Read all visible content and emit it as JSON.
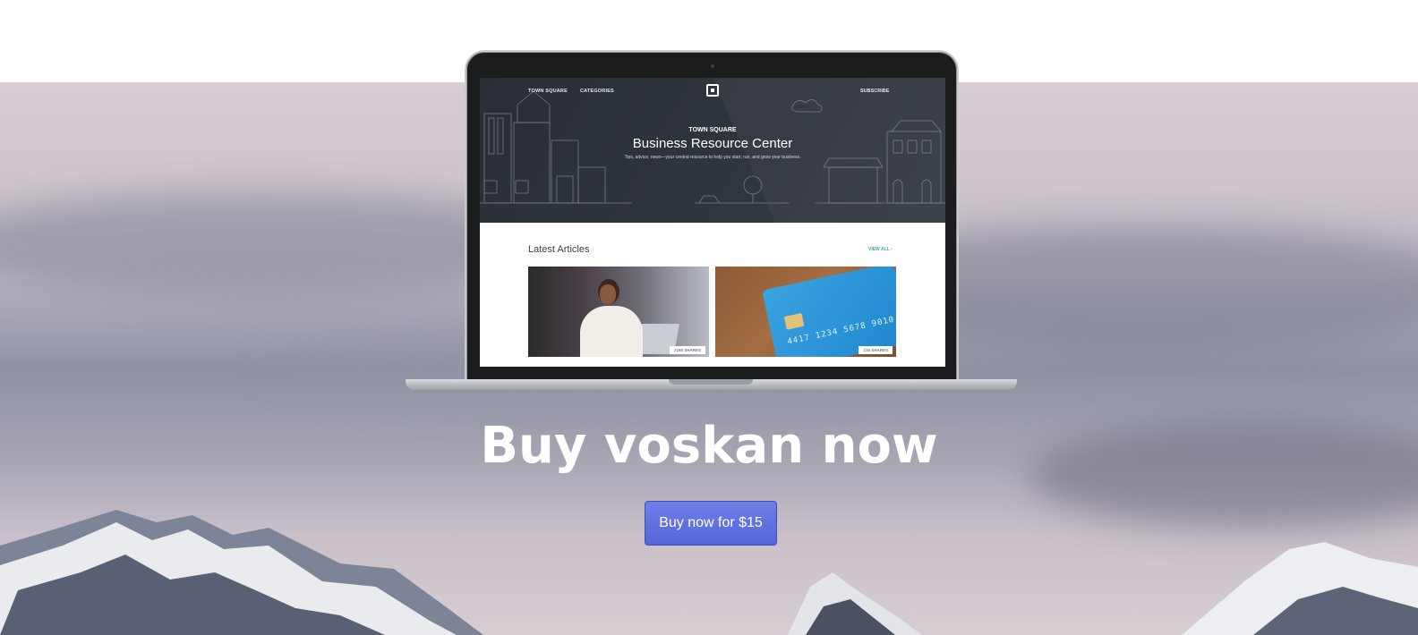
{
  "hero": {
    "headline": "Buy voskan now",
    "cta_label": "Buy now for $15"
  },
  "screen": {
    "nav": {
      "left_items": [
        "TOWN SQUARE",
        "CATEGORIES"
      ],
      "right_item": "SUBSCRIBE"
    },
    "header": {
      "kicker": "TOWN SQUARE",
      "title": "Business Resource Center",
      "tagline": "Tips, advice, news—your central resource to help you start, run, and grow your business."
    },
    "section": {
      "title": "Latest Articles",
      "view_all": "VIEW ALL ›"
    },
    "articles": [
      {
        "shares": "2165 SHARES"
      },
      {
        "shares": "135 SHARES",
        "card_number": "4417 1234 5678 9010"
      }
    ]
  },
  "colors": {
    "cta": "#5a6ae0",
    "site_header": "#2e343b",
    "accent_link": "#3aa6a0"
  }
}
